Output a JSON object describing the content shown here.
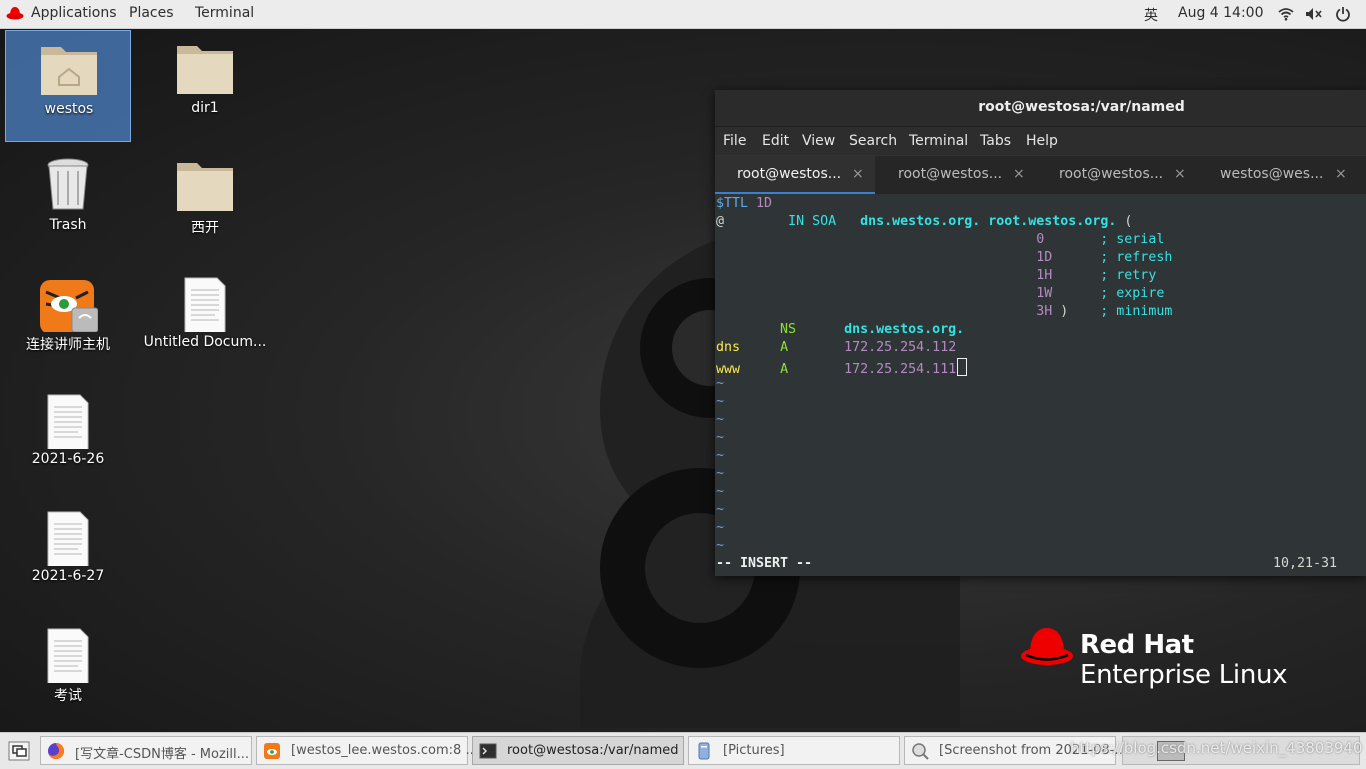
{
  "topbar": {
    "applications": "Applications",
    "places": "Places",
    "terminal": "Terminal",
    "input_method": "英",
    "datetime": "Aug 4  14:00"
  },
  "desktop": {
    "icons": [
      {
        "label": "westos",
        "icon": "home-folder-icon"
      },
      {
        "label": "dir1",
        "icon": "folder-icon"
      },
      {
        "label": "Trash",
        "icon": "trash-icon"
      },
      {
        "label": "西开",
        "icon": "folder-icon"
      },
      {
        "label": "连接讲师主机",
        "icon": "remote-viewer-icon"
      },
      {
        "label": "Untitled Docum...",
        "icon": "document-icon"
      },
      {
        "label": "2021-6-26",
        "icon": "document-icon"
      },
      {
        "label": "2021-6-27",
        "icon": "document-icon"
      },
      {
        "label": "考试",
        "icon": "document-icon"
      }
    ]
  },
  "terminal": {
    "title": "root@westosa:/var/named",
    "menu": [
      "File",
      "Edit",
      "View",
      "Search",
      "Terminal",
      "Tabs",
      "Help"
    ],
    "tabs": [
      {
        "label": "root@westos...",
        "close": "×"
      },
      {
        "label": "root@westos...",
        "close": "×"
      },
      {
        "label": "root@westos...",
        "close": "×"
      },
      {
        "label": "westos@wes...",
        "close": "×"
      }
    ],
    "lines": {
      "l1a": "$TTL",
      "l1b": "1D",
      "l2a": "@",
      "l2b": "IN SOA",
      "l2c": "dns.westos.org.",
      "l2d": "root.westos.org.",
      "l2e": "(",
      "l3a": "0",
      "l3b": "; serial",
      "l4a": "1D",
      "l4b": "; refresh",
      "l5a": "1H",
      "l5b": "; retry",
      "l6a": "1W",
      "l6b": "; expire",
      "l7a": "3H",
      "l7p": ")",
      "l7b": "; minimum",
      "l8a": "NS",
      "l8b": "dns.westos.org.",
      "l9a": "dns",
      "l9b": "A",
      "l9c": "172.25.254.112",
      "l10a": "www",
      "l10b": "A",
      "l10c": "172.25.254.111",
      "tilde": "~",
      "mode": "-- INSERT --",
      "position": "10,21-31"
    }
  },
  "brand": {
    "line1": "Red Hat",
    "line2": "Enterprise Linux"
  },
  "taskbar": {
    "items": [
      {
        "label": "[写文章-CSDN博客 - Mozill...",
        "icon": "firefox-icon"
      },
      {
        "label": "[westos_lee.westos.com:8 ...",
        "icon": "remote-viewer-icon"
      },
      {
        "label": "root@westosa:/var/named",
        "icon": "terminal-icon"
      },
      {
        "label": "[Pictures]",
        "icon": "file-manager-icon"
      },
      {
        "label": "[Screenshot from 2021-08-...",
        "icon": "screenshot-icon"
      }
    ],
    "watermark": "https://blog.csdn.net/weixin_43803940"
  },
  "colors": {
    "accent": "#3b7fd0",
    "redhat_red": "#ee0000",
    "terminal_bg": "#2f3436"
  }
}
